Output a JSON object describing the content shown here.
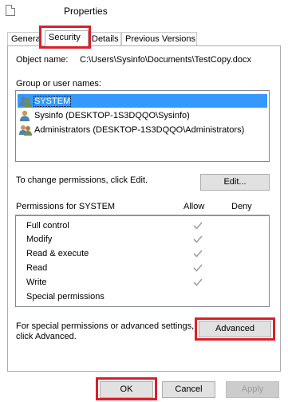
{
  "window": {
    "title": "Properties"
  },
  "tabs": [
    {
      "label": "General"
    },
    {
      "label": "Security"
    },
    {
      "label": "Details"
    },
    {
      "label": "Previous Versions"
    }
  ],
  "object": {
    "label": "Object name:",
    "value": "C:\\Users\\Sysinfo\\Documents\\TestCopy.docx"
  },
  "groups": {
    "label": "Group or user names:",
    "items": [
      {
        "name": "SYSTEM",
        "selected": true,
        "icon": "user-group-icon"
      },
      {
        "name": "Sysinfo (DESKTOP-1S3DQQO\\Sysinfo)",
        "selected": false,
        "icon": "user-icon"
      },
      {
        "name": "Administrators (DESKTOP-1S3DQQO\\Administrators)",
        "selected": false,
        "icon": "user-group-icon"
      }
    ]
  },
  "change_note": "To change permissions, click Edit.",
  "edit_button": "Edit...",
  "permissions": {
    "title": "Permissions for SYSTEM",
    "allow_label": "Allow",
    "deny_label": "Deny",
    "rows": [
      {
        "name": "Full control",
        "allow": true
      },
      {
        "name": "Modify",
        "allow": true
      },
      {
        "name": "Read & execute",
        "allow": true
      },
      {
        "name": "Read",
        "allow": true
      },
      {
        "name": "Write",
        "allow": true
      },
      {
        "name": "Special permissions",
        "allow": false
      }
    ]
  },
  "advanced": {
    "note_line1": "For special permissions or advanced settings,",
    "note_line2": "click Advanced.",
    "button": "Advanced"
  },
  "footer": {
    "ok": "OK",
    "cancel": "Cancel",
    "apply": "Apply"
  },
  "colors": {
    "highlight": "#d9202a",
    "selection": "#3399ff"
  }
}
